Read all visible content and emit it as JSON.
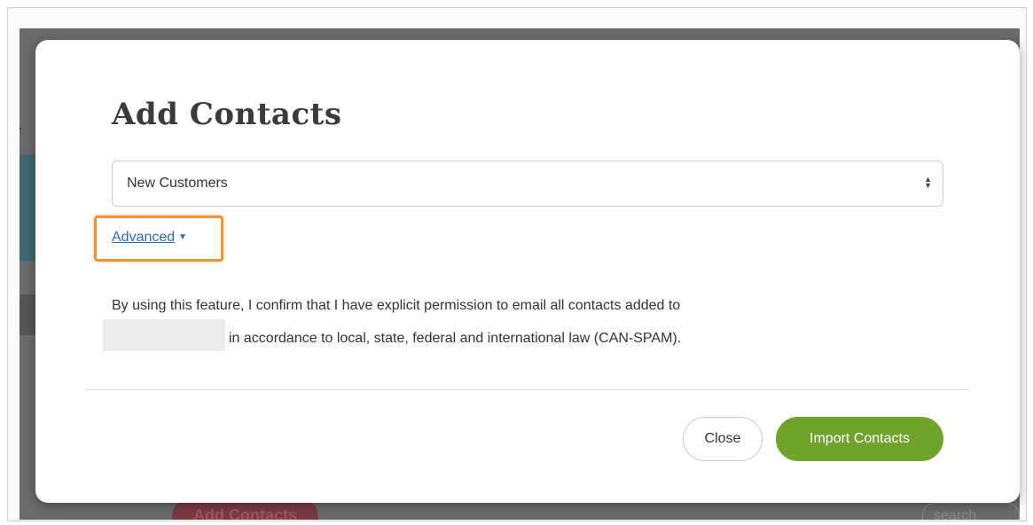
{
  "modal": {
    "title": "Add Contacts",
    "list_select": {
      "selected": "New Customers"
    },
    "advanced_link": "Advanced",
    "disclaimer": {
      "line1": "By using this feature, I confirm that I have explicit permission to email all contacts added to",
      "line2": "in accordance to local, state, federal and international law (CAN-SPAM)."
    },
    "buttons": {
      "close": "Close",
      "import": "Import Contacts"
    }
  },
  "background": {
    "add_contacts_button": "Add Contacts",
    "search_placeholder": "search"
  },
  "colors": {
    "import_button": "#6fa32c",
    "advanced_highlight": "#f0922e",
    "link": "#2a6fa8",
    "backdrop": "#6b6b6b"
  },
  "icons": {
    "select_arrows": "select-updown-icon",
    "advanced_caret": "caret-down-icon"
  }
}
